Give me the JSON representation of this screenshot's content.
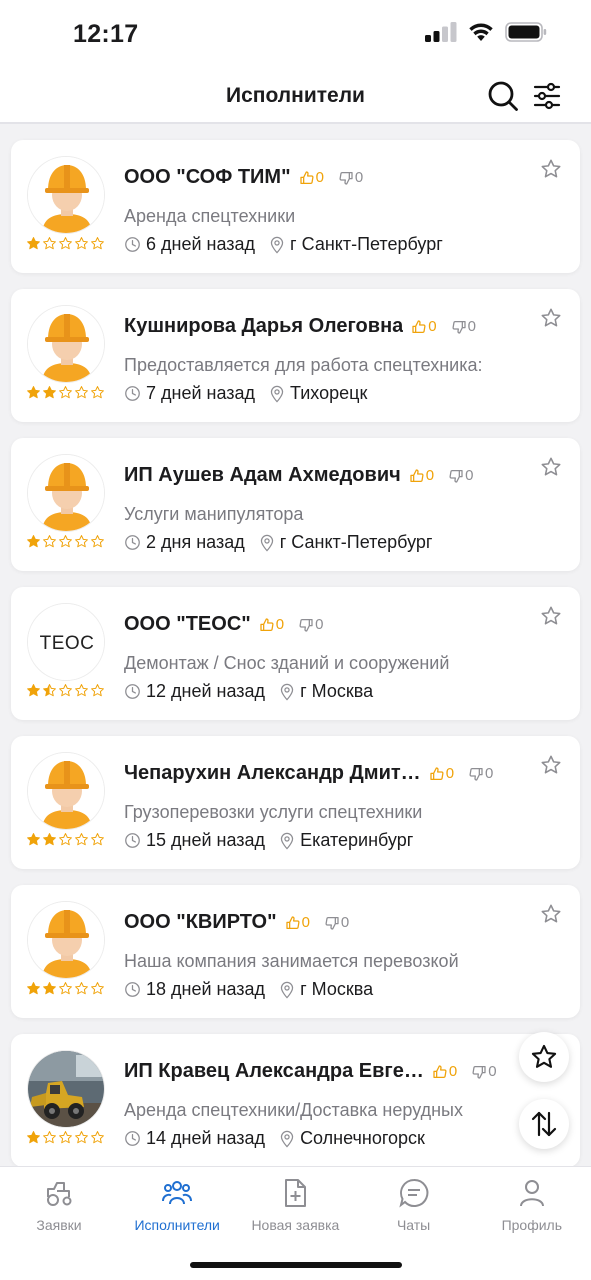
{
  "status_bar": {
    "time": "12:17"
  },
  "header": {
    "title": "Исполнители"
  },
  "colors": {
    "accent": "#1f6fd1",
    "like": "#f0a30a",
    "star": "#f0a30a",
    "muted": "#8e8e93"
  },
  "performers": [
    {
      "name": "ООО \"СОФ ТИМ\"",
      "likes": "0",
      "dislikes": "0",
      "description": "Аренда спецтехники",
      "time": "6 дней назад",
      "location": "г Санкт-Петербург",
      "rating": 1,
      "avatar": "worker-avatar"
    },
    {
      "name": "Кушнирова Дарья Олеговна",
      "likes": "0",
      "dislikes": "0",
      "description": "Предоставляется для работа спецтехника:",
      "time": "7 дней назад",
      "location": "Тихорецк",
      "rating": 2,
      "avatar": "worker-avatar"
    },
    {
      "name": "ИП Аушев Адам Ахмедович",
      "likes": "0",
      "dislikes": "0",
      "description": "Услуги манипулятора",
      "time": "2 дня назад",
      "location": "г Санкт-Петербург",
      "rating": 1,
      "avatar": "worker-avatar"
    },
    {
      "name": "ООО \"ТЕОС\"",
      "likes": "0",
      "dislikes": "0",
      "description": "Демонтаж / Снос зданий и сооружений",
      "time": "12 дней назад",
      "location": "г Москва",
      "rating": 1.5,
      "avatar": "teos-logo",
      "logo_text": "ТЕОС"
    },
    {
      "name": "Чепарухин Александр Дмит…",
      "likes": "0",
      "dislikes": "0",
      "description": "Грузоперевозки услуги спецтехники",
      "time": "15 дней назад",
      "location": "Екатеринбург",
      "rating": 2,
      "avatar": "worker-avatar"
    },
    {
      "name": "ООО \"КВИРТО\"",
      "likes": "0",
      "dislikes": "0",
      "description": "Наша компания занимается перевозкой",
      "time": "18 дней назад",
      "location": "г Москва",
      "rating": 2,
      "avatar": "worker-avatar"
    },
    {
      "name": "ИП Кравец Александра Евге…",
      "likes": "0",
      "dislikes": "0",
      "description": "Аренда спецтехники/Доставка нерудных",
      "time": "14 дней назад",
      "location": "Солнечногорск",
      "rating": 1,
      "avatar": "loader-photo"
    }
  ],
  "tabs": [
    {
      "label": "Заявки",
      "icon": "tractor-icon",
      "active": false
    },
    {
      "label": "Исполнители",
      "icon": "people-icon",
      "active": true
    },
    {
      "label": "Новая заявка",
      "icon": "new-document-icon",
      "active": false
    },
    {
      "label": "Чаты",
      "icon": "chat-icon",
      "active": false
    },
    {
      "label": "Профиль",
      "icon": "profile-icon",
      "active": false
    }
  ]
}
